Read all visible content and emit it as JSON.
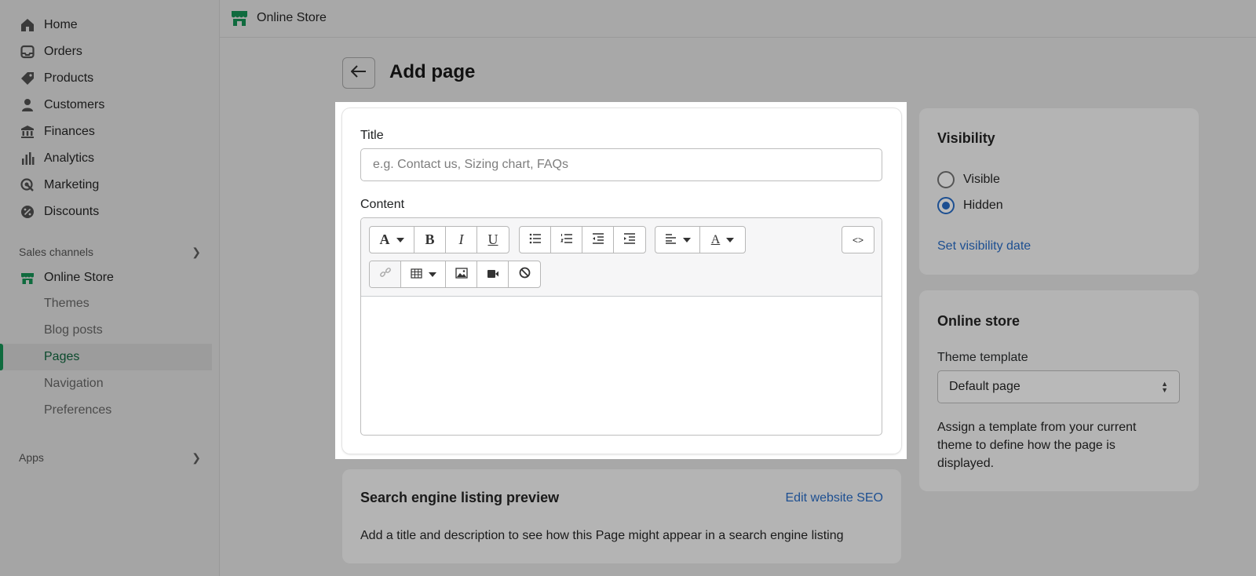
{
  "sidebar": {
    "items": [
      {
        "label": "Home",
        "icon": "home-icon"
      },
      {
        "label": "Orders",
        "icon": "inbox-icon"
      },
      {
        "label": "Products",
        "icon": "tag-icon"
      },
      {
        "label": "Customers",
        "icon": "person-icon"
      },
      {
        "label": "Finances",
        "icon": "bank-icon"
      },
      {
        "label": "Analytics",
        "icon": "bar-chart-icon"
      },
      {
        "label": "Marketing",
        "icon": "target-icon"
      },
      {
        "label": "Discounts",
        "icon": "discount-icon"
      }
    ],
    "sales_channels_label": "Sales channels",
    "online_store_label": "Online Store",
    "sub_items": [
      {
        "label": "Themes"
      },
      {
        "label": "Blog posts"
      },
      {
        "label": "Pages",
        "active": true
      },
      {
        "label": "Navigation"
      },
      {
        "label": "Preferences"
      }
    ],
    "apps_label": "Apps"
  },
  "topbar": {
    "store_name": "Online Store"
  },
  "page": {
    "title": "Add page"
  },
  "form": {
    "title_label": "Title",
    "title_placeholder": "e.g. Contact us, Sizing chart, FAQs",
    "title_value": "",
    "content_label": "Content",
    "html_toggle": "<>"
  },
  "seo": {
    "title": "Search engine listing preview",
    "edit_link": "Edit website SEO",
    "description": "Add a title and description to see how this Page might appear in a search engine listing"
  },
  "visibility": {
    "title": "Visibility",
    "options": [
      {
        "label": "Visible",
        "selected": false
      },
      {
        "label": "Hidden",
        "selected": true
      }
    ],
    "set_date_link": "Set visibility date"
  },
  "online_store": {
    "title": "Online store",
    "template_label": "Theme template",
    "template_value": "Default page",
    "help": "Assign a template from your current theme to define how the page is displayed."
  },
  "colors": {
    "accent": "#1d4f91",
    "brand_green": "#0f6b3e",
    "overlay": "#a8a8a8"
  }
}
